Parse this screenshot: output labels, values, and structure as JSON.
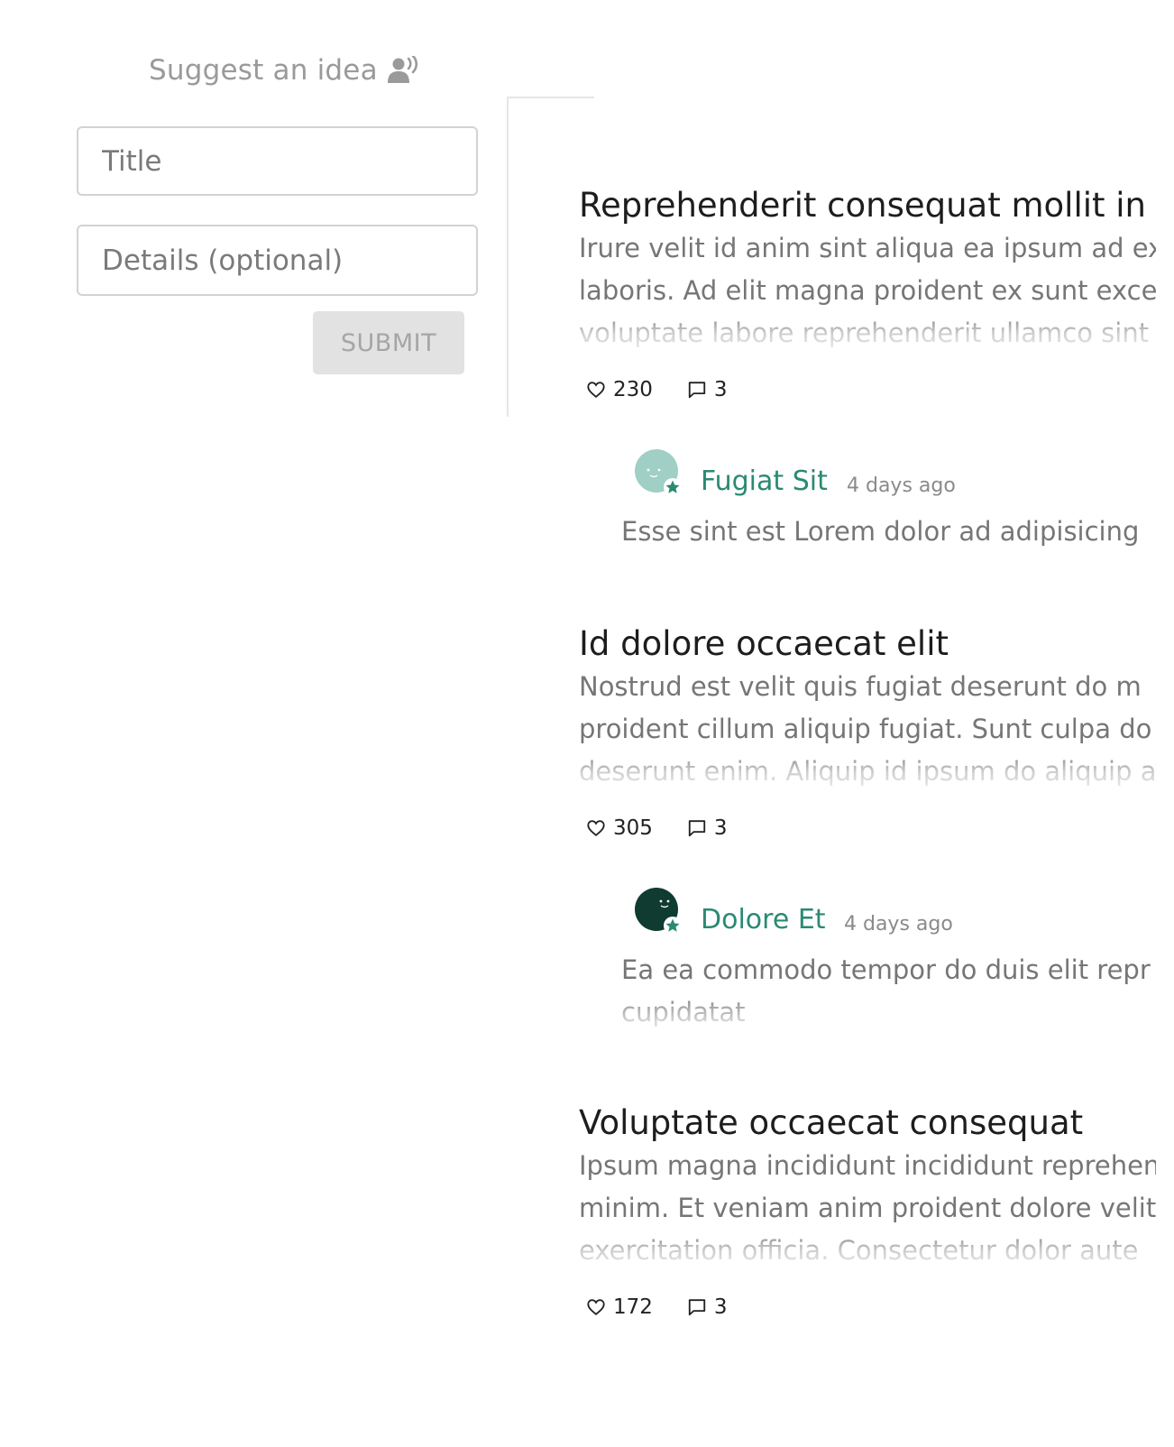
{
  "suggest_form": {
    "heading": "Suggest an idea",
    "heading_icon": "user-voice-icon",
    "title_placeholder": "Title",
    "details_placeholder": "Details (optional)",
    "submit_label": "SUBMIT"
  },
  "posts": [
    {
      "title": "Reprehenderit consequat mollit in",
      "body_lines": [
        "Irure velit id anim sint aliqua ea ipsum ad ex",
        "laboris. Ad elit magna proident ex sunt exce",
        "voluptate labore reprehenderit ullamco sint"
      ],
      "likes": "230",
      "comments": "3",
      "top_comment": {
        "author": "Fugiat Sit",
        "time": "4 days ago",
        "text": "Esse sint est Lorem dolor ad adipisicing",
        "avatar_color": "#9fcfc5"
      }
    },
    {
      "title": "Id dolore occaecat elit",
      "body_lines": [
        "Nostrud est velit quis fugiat deserunt do m",
        "proident cillum aliquip fugiat. Sunt culpa do",
        "deserunt enim. Aliquip id ipsum do aliquip a"
      ],
      "likes": "305",
      "comments": "3",
      "top_comment": {
        "author": "Dolore Et",
        "time": "4 days ago",
        "text": "Ea ea commodo tempor do duis elit repr",
        "text_line2": "cupidatat",
        "avatar_color": "#0f3b30"
      }
    },
    {
      "title": "Voluptate occaecat consequat",
      "body_lines": [
        "Ipsum magna incididunt incididunt reprehen",
        "minim. Et veniam anim proident dolore velit",
        "exercitation officia. Consectetur dolor aute"
      ],
      "likes": "172",
      "comments": "3"
    }
  ],
  "colors": {
    "accent": "#2a8a72",
    "muted_text": "#767676",
    "button_bg": "#e2e2e2"
  },
  "icons": {
    "like": "heart-outline-icon",
    "comment": "comment-bubble-icon",
    "badge": "star-badge-icon"
  }
}
